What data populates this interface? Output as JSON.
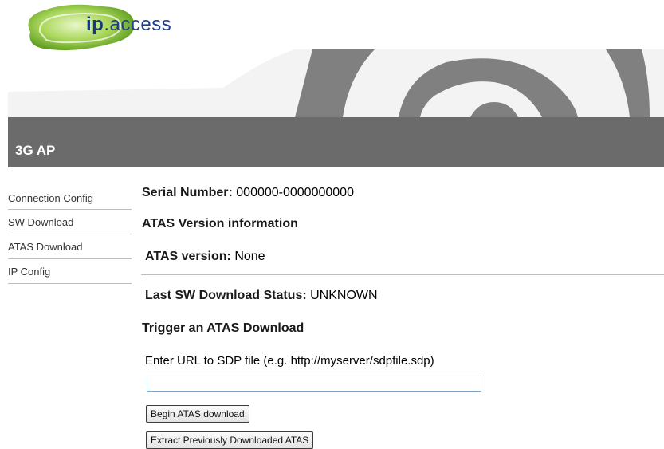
{
  "brand": {
    "logo_ip": "ip",
    "logo_dot": ".",
    "logo_rest": "access"
  },
  "header": {
    "title": "3G AP"
  },
  "sidebar": {
    "items": [
      {
        "label": "Connection Config"
      },
      {
        "label": "SW Download"
      },
      {
        "label": "ATAS Download"
      },
      {
        "label": "IP Config"
      }
    ]
  },
  "main": {
    "serial_label": "Serial Number:",
    "serial_value": "000000-0000000000",
    "atas_version_heading": "ATAS Version information",
    "atas_version_label": "ATAS version:",
    "atas_version_value": "None",
    "last_sw_label": "Last SW Download Status:",
    "last_sw_value": "UNKNOWN",
    "trigger_heading": "Trigger an ATAS Download",
    "url_prompt": "Enter URL to SDP file (e.g. http://myserver/sdpfile.sdp)",
    "url_input": {
      "value": "",
      "placeholder": ""
    },
    "begin_button": "Begin ATAS download",
    "extract_button": "Extract Previously Downloaded ATAS"
  },
  "colors": {
    "titlebar": "#6b6b6b",
    "arc": "#808080",
    "logo_blob": "#8cc63f"
  }
}
